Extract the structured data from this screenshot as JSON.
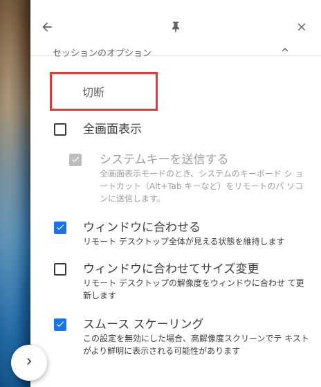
{
  "panel": {
    "header": {
      "back_icon": "arrow-left-icon",
      "pin_icon": "pin-icon",
      "close_icon": "close-icon"
    },
    "section": {
      "title": "セッションのオプション",
      "collapse_icon": "chevron-up-icon"
    },
    "disconnect": {
      "label": "切断"
    },
    "options": [
      {
        "title": "全画面表示",
        "desc": "",
        "checked": false,
        "disabled": false
      },
      {
        "title": "システムキーを送信する",
        "desc": "全画面表示モードのとき、システムのキーボード シ ョートカット（Alt+Tab キーなど）をリモートのパ ソコンに送信します。",
        "checked": true,
        "disabled": true
      },
      {
        "title": "ウィンドウに合わせる",
        "desc": "リモート デスクトップ全体が見える状態を維持します",
        "checked": true,
        "disabled": false
      },
      {
        "title": "ウィンドウに合わせてサイズ変更",
        "desc": "リモート デスクトップの解像度をウィンドウに合わせ て更新します",
        "checked": false,
        "disabled": false
      },
      {
        "title": "スムース スケーリング",
        "desc": "この設定を無効にした場合、高解像度スクリーンでテ キストがより鮮明に表示される可能性があります",
        "checked": true,
        "disabled": false
      }
    ],
    "expander_icon": "chevron-right-icon"
  },
  "colors": {
    "accent": "#1a73e8",
    "highlight_border": "#e53935",
    "disabled": "#bdbdbd"
  }
}
